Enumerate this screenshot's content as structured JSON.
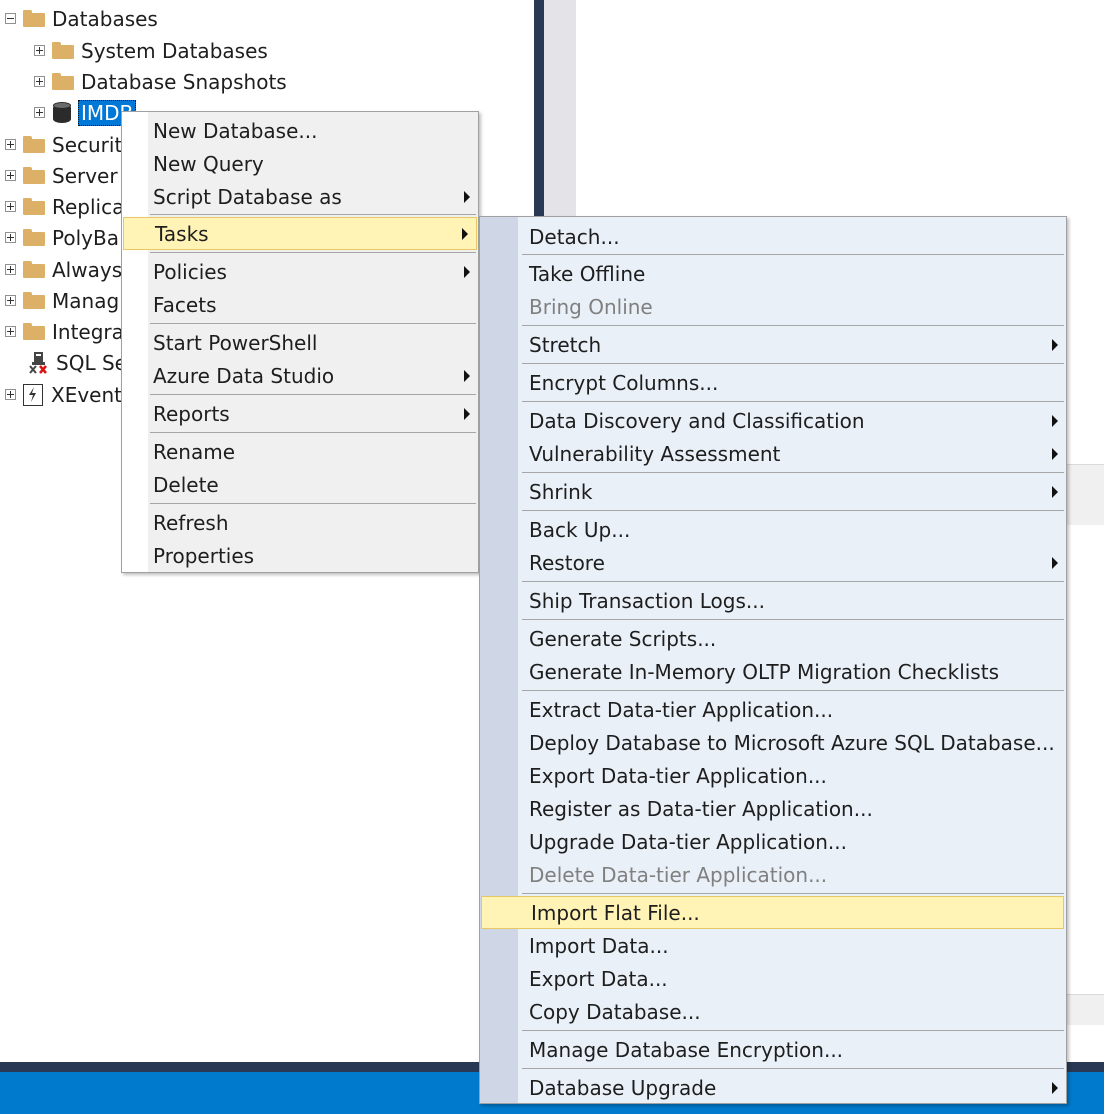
{
  "tree": {
    "databases": "Databases",
    "system_databases": "System Databases",
    "database_snapshots": "Database Snapshots",
    "imdb": "IMDB",
    "security": "Securit",
    "server": "Server",
    "replication": "Replica",
    "polybase": "PolyBa",
    "always_on": "Always",
    "management": "Manag",
    "integration": "Integra",
    "sql_server_agent": "SQL Se",
    "xevent": "XEvent"
  },
  "context_menu": {
    "new_database": "New Database...",
    "new_query": "New Query",
    "script_database_as": "Script Database as",
    "tasks": "Tasks",
    "policies": "Policies",
    "facets": "Facets",
    "start_powershell": "Start PowerShell",
    "azure_data_studio": "Azure Data Studio",
    "reports": "Reports",
    "rename": "Rename",
    "delete": "Delete",
    "refresh": "Refresh",
    "properties": "Properties"
  },
  "tasks_menu": {
    "detach": "Detach...",
    "take_offline": "Take Offline",
    "bring_online": "Bring Online",
    "stretch": "Stretch",
    "encrypt_columns": "Encrypt Columns...",
    "data_discovery": "Data Discovery and Classification",
    "vulnerability_assessment": "Vulnerability Assessment",
    "shrink": "Shrink",
    "back_up": "Back Up...",
    "restore": "Restore",
    "ship_transaction_logs": "Ship Transaction Logs...",
    "generate_scripts": "Generate Scripts...",
    "generate_inmemory": "Generate In-Memory OLTP Migration Checklists",
    "extract_dac": "Extract Data-tier Application...",
    "deploy_azure": "Deploy Database to Microsoft Azure SQL Database...",
    "export_dac": "Export Data-tier Application...",
    "register_dac": "Register as Data-tier Application...",
    "upgrade_dac": "Upgrade Data-tier Application...",
    "delete_dac": "Delete Data-tier Application...",
    "import_flat_file": "Import Flat File...",
    "import_data": "Import Data...",
    "export_data": "Export Data...",
    "copy_database": "Copy Database...",
    "manage_encryption": "Manage Database Encryption...",
    "database_upgrade": "Database Upgrade"
  },
  "colors": {
    "highlight": "#fff3b5",
    "selection": "#0078d7",
    "statusbar": "#007acc"
  }
}
